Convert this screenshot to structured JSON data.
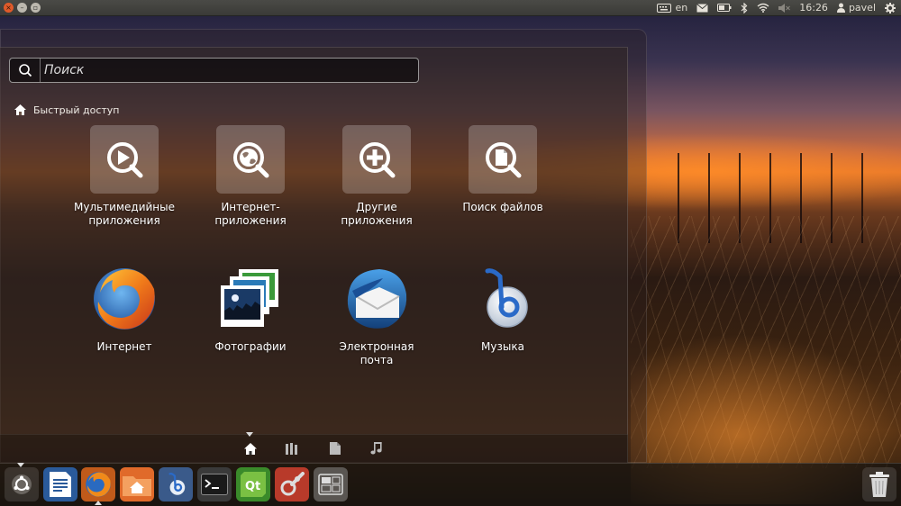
{
  "top_panel": {
    "keyboard_layout": "en",
    "time": "16:26",
    "user": "pavel",
    "icons": [
      "keyboard-icon",
      "mail-icon",
      "battery-icon",
      "bluetooth-icon",
      "wifi-icon",
      "volume-muted-icon",
      "user-icon",
      "gear-icon"
    ]
  },
  "dash": {
    "search": {
      "placeholder": "Поиск",
      "value": ""
    },
    "section_title": "Быстрый доступ",
    "shortcuts": [
      {
        "label": "Мультимедийные приложения",
        "icon": "media-apps-icon"
      },
      {
        "label": "Интернет-приложения",
        "icon": "internet-apps-icon"
      },
      {
        "label": "Другие приложения",
        "icon": "more-apps-icon"
      },
      {
        "label": "Поиск файлов",
        "icon": "find-files-icon"
      }
    ],
    "favorites": [
      {
        "label": "Интернет",
        "icon": "firefox-icon"
      },
      {
        "label": "Фотографии",
        "icon": "photos-icon"
      },
      {
        "label": "Электронная почта",
        "icon": "thunderbird-icon"
      },
      {
        "label": "Музыка",
        "icon": "banshee-icon"
      }
    ],
    "lenses": [
      "home-lens-icon",
      "applications-lens-icon",
      "files-lens-icon",
      "music-lens-icon"
    ]
  },
  "launcher": {
    "items": [
      "ubuntu-button-icon",
      "libreoffice-writer-icon",
      "firefox-icon",
      "home-folder-icon",
      "banshee-icon",
      "terminal-icon",
      "qt-creator-icon",
      "system-settings-icon",
      "workspace-switcher-icon",
      "trash-icon"
    ]
  },
  "colors": {
    "accent": "#e05a2a",
    "panel": "#3c3b37"
  }
}
